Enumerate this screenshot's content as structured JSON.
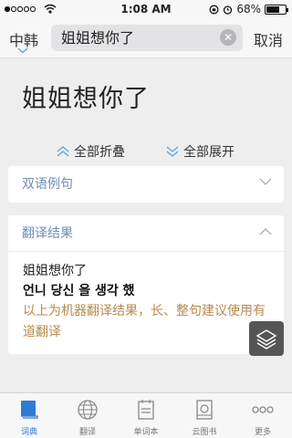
{
  "status_bar": {
    "time": "1:08 AM",
    "battery": "68%",
    "battery_level": 0.68
  },
  "search": {
    "lang_switch": "中韩",
    "query": "姐姐想你了",
    "cancel_label": "取消"
  },
  "result": {
    "word": "姐姐想你了",
    "collapse_all": "全部折叠",
    "expand_all": "全部展开"
  },
  "sections": {
    "bilingual_title": "双语例句",
    "translation_title": "翻译结果",
    "source_text": "姐姐想你了",
    "translated_text": "언니 당신 을 생각 했",
    "note": "以上为机器翻译结果，长、整句建议使用有道翻译"
  },
  "tabs": [
    {
      "label": "词典",
      "icon": "dictionary-icon",
      "active": true
    },
    {
      "label": "翻译",
      "icon": "globe-icon",
      "active": false
    },
    {
      "label": "单词本",
      "icon": "wordbook-icon",
      "active": false
    },
    {
      "label": "云图书",
      "icon": "cloud-book-icon",
      "active": false
    },
    {
      "label": "更多",
      "icon": "more-icon",
      "active": false
    }
  ],
  "colors": {
    "accent": "#2e7bd6",
    "section_title": "#6f8db3",
    "note": "#b78a4e"
  }
}
